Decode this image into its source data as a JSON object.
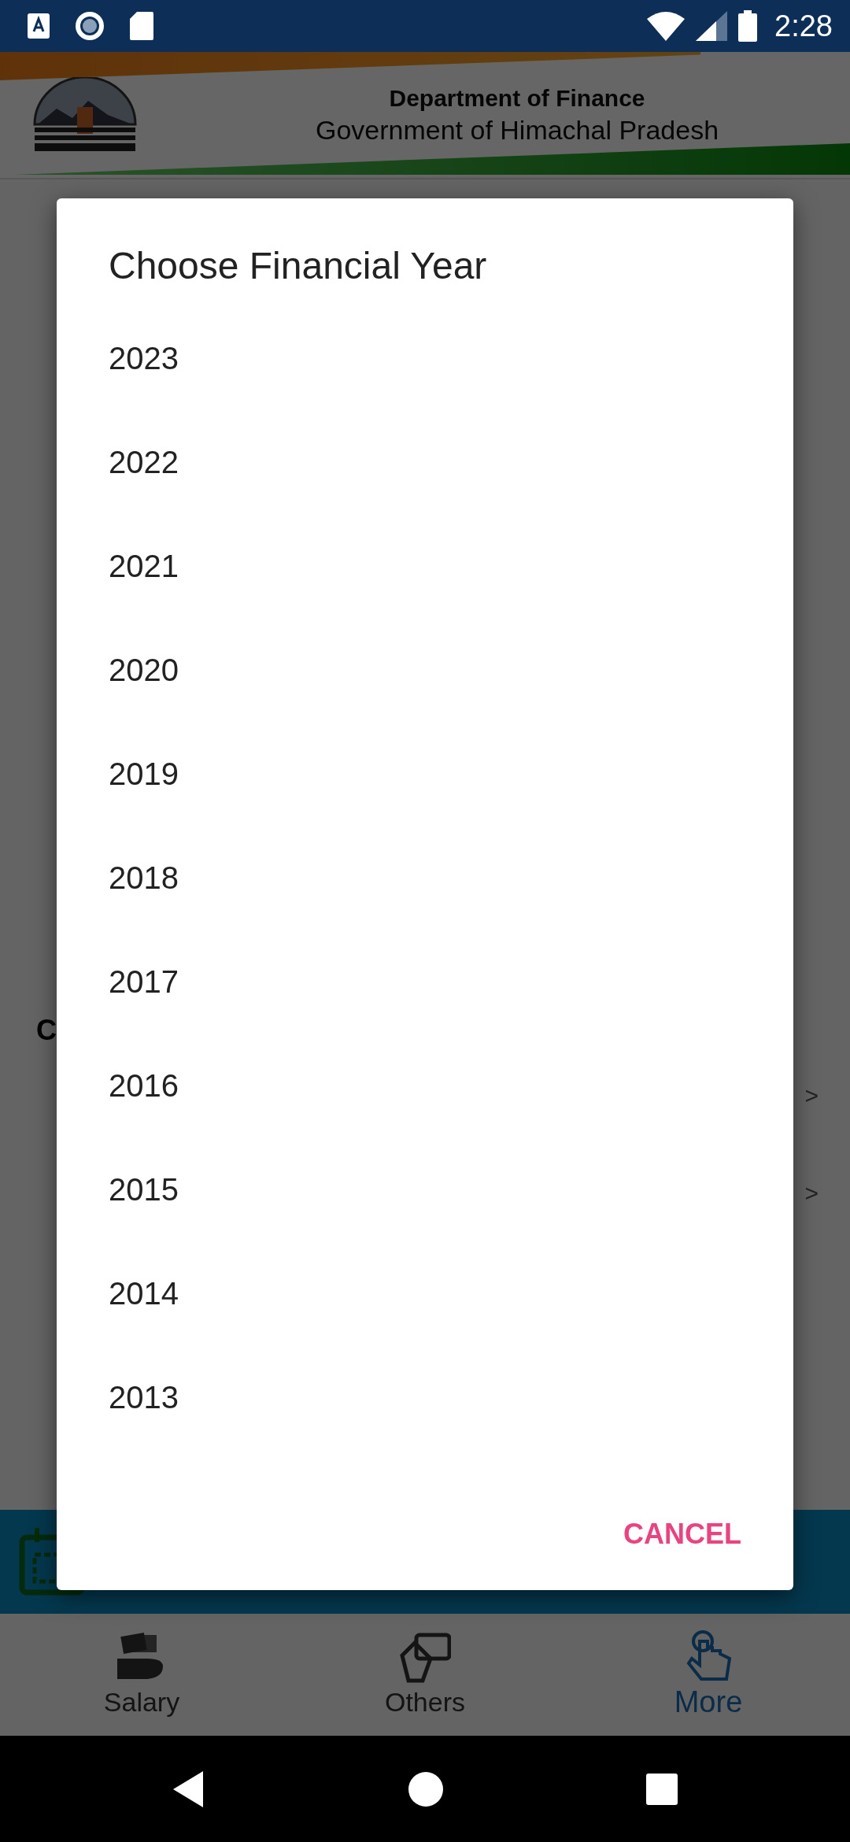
{
  "status_bar": {
    "time": "2:28"
  },
  "header": {
    "title": "Department of Finance",
    "subtitle": "Government of Himachal Pradesh"
  },
  "background": {
    "section_heading": "C",
    "rows": [
      {
        "chevron": ">"
      },
      {
        "chevron": ">"
      }
    ]
  },
  "dialog": {
    "title": "Choose Financial Year",
    "options": [
      "2023",
      "2022",
      "2021",
      "2020",
      "2019",
      "2018",
      "2017",
      "2016",
      "2015",
      "2014",
      "2013"
    ],
    "cancel": "CANCEL"
  },
  "bottom_nav": [
    {
      "label": "Salary",
      "kind": "salary",
      "selected": false
    },
    {
      "label": "Others",
      "kind": "others",
      "selected": false
    },
    {
      "label": "More",
      "kind": "more",
      "selected": true
    }
  ]
}
